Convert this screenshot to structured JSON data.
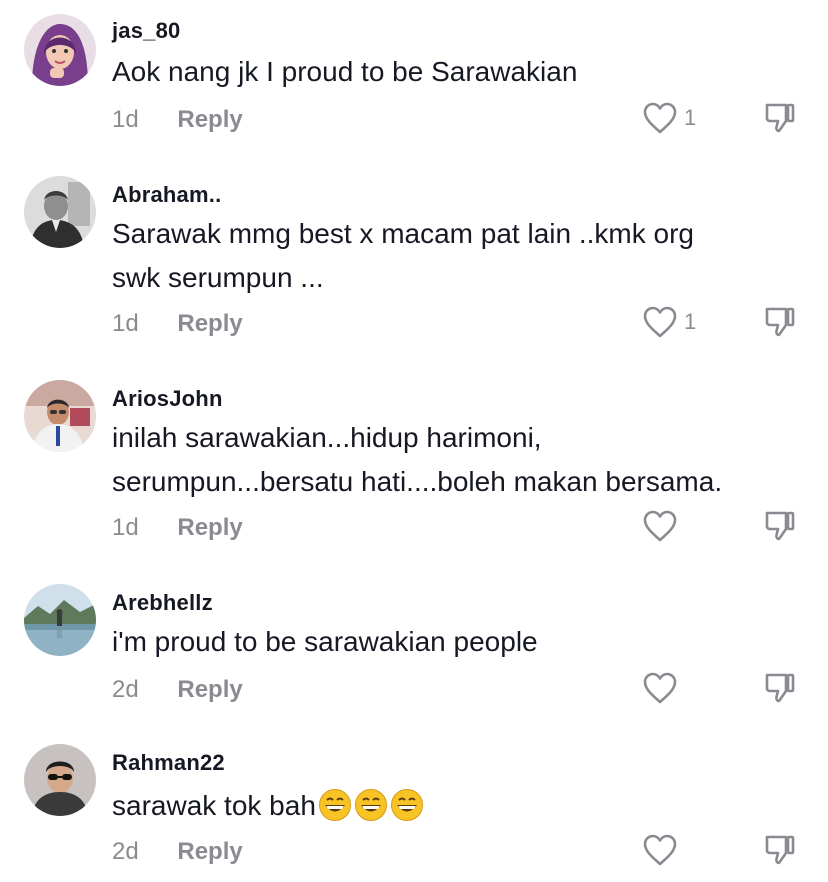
{
  "comments": [
    {
      "username": "jas_80",
      "lines": [
        "Aok nang jk I proud to be Sarawakian"
      ],
      "time": "1d",
      "reply_label": "Reply",
      "likes": "1"
    },
    {
      "username": "Abraham..",
      "lines": [
        "Sarawak mmg best x macam pat lain ..kmk org",
        "swk serumpun ..."
      ],
      "time": "1d",
      "reply_label": "Reply",
      "likes": "1"
    },
    {
      "username": "AriosJohn",
      "lines": [
        "inilah sarawakian...hidup harimoni,",
        "serumpun...bersatu hati....boleh makan bersama."
      ],
      "time": "1d",
      "reply_label": "Reply",
      "likes": ""
    },
    {
      "username": "Arebhellz",
      "lines": [
        "i'm proud to be sarawakian people"
      ],
      "time": "2d",
      "reply_label": "Reply",
      "likes": ""
    },
    {
      "username": "Rahman22",
      "lines": [
        "sarawak tok bah"
      ],
      "emoji": [
        "grinning-face-emoji",
        "grinning-face-emoji",
        "grinning-face-emoji"
      ],
      "time": "2d",
      "reply_label": "Reply",
      "likes": ""
    }
  ],
  "icons": {
    "like": "heart-outline-icon",
    "dislike": "thumbs-down-icon"
  },
  "colors": {
    "text": "#161823",
    "muted": "#8a8b91",
    "emoji_face": "#f7c325"
  }
}
